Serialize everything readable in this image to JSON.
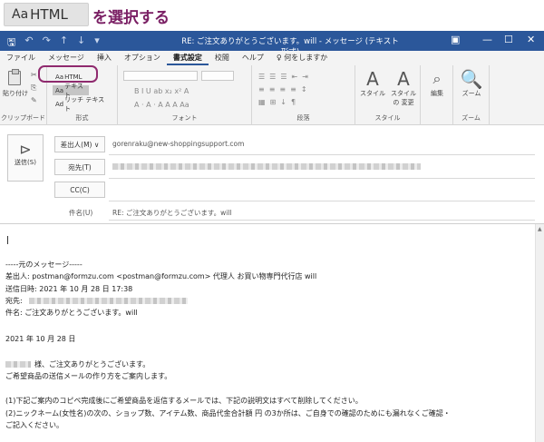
{
  "caption": {
    "chip_aa": "Aa",
    "chip_label": "HTML",
    "text": "を選択する"
  },
  "titlebar": {
    "title": "RE: ご注文ありがとうございます。will  -  メッセージ (テキスト形式)",
    "qa": [
      "🖫",
      "↶",
      "↷",
      "↑",
      "↓",
      "▾"
    ],
    "win": [
      "▣",
      "—",
      "☐",
      "✕"
    ]
  },
  "tabs": [
    "ファイル",
    "メッセージ",
    "挿入",
    "オプション",
    "書式設定",
    "校閲",
    "ヘルプ",
    "♀ 何をしますか"
  ],
  "ribbon": {
    "paste_label": "貼り付け",
    "clipboard_label": "クリップボード",
    "format_label": "形式",
    "html_aa": "Aa",
    "html_label": "HTML",
    "text_aa": "Aa",
    "text_label": "テキスト",
    "rich_aa": "Ad",
    "rich_label": "リッチ テキスト",
    "font_label": "フォント",
    "para_label": "段落",
    "style_label": "スタイル",
    "zoom_label": "ズーム",
    "style_btn": "スタイル",
    "style_change_btn": "スタイルの 変更",
    "edit_btn": "編集",
    "zoom_btn": "ズーム",
    "font_row1": "B  I  U  ab  x₂  x²  A",
    "font_row2": "A  ·  A  ·  A  A  A  Aa"
  },
  "header": {
    "send_label": "送信(S)",
    "from_btn": "差出人(M) ∨",
    "from_value": "gorenraku@new-shoppingsupport.com",
    "to_btn": "宛先(T)",
    "cc_btn": "CC(C)",
    "subject_label": "件名(U)",
    "subject_value": "RE: ご注文ありがとうございます。will"
  },
  "body": {
    "lines": [
      "-----元のメッセージ-----",
      "差出人: postman@formzu.com <postman@formzu.com> 代理人 お買い物専門代行店 will",
      "送信日時: 2021 年 10 月 28 日  17:38",
      "宛先:",
      "件名: ご注文ありがとうございます。will",
      "2021 年 10 月 28 日",
      "様、ご注文ありがとうございます。",
      "ご希望商品の送信メールの作り方をご案内します。",
      "(1)下記ご案内のコピペ完成後にご希望商品を返信するメールでは、下記の説明文はすべて削除してください。",
      "(2)ニックネーム(女性名)の次の、ショップ数、アイテム数、商品代金合計額  円  の3か所は、ご自身での確認のためにも漏れなくご確認・",
      "ご記入ください。"
    ]
  }
}
